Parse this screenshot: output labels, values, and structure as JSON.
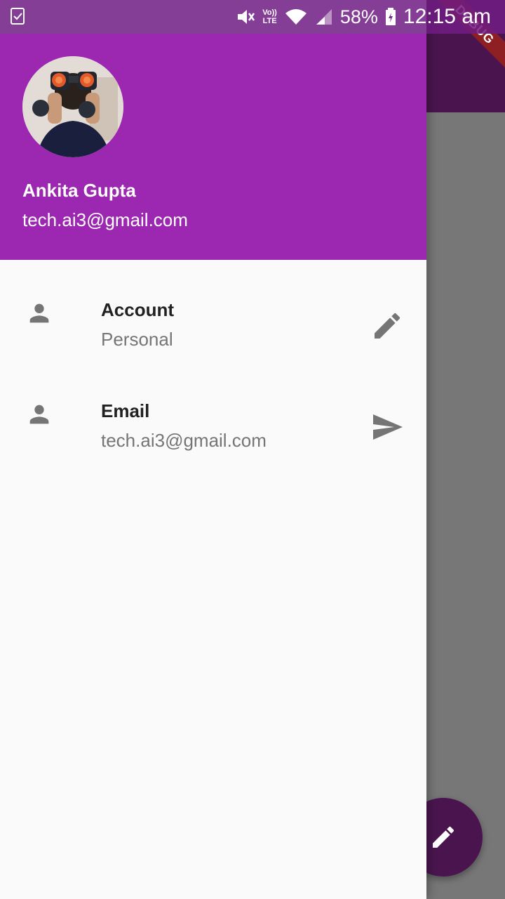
{
  "status_bar": {
    "battery": "58%",
    "time": "12:15 am",
    "network": "LTE",
    "volte": "Vo))"
  },
  "debug_banner": {
    "label": "DEBUG"
  },
  "drawer": {
    "header": {
      "account_name": "Ankita Gupta",
      "account_email": "tech.ai3@gmail.com"
    },
    "items": [
      {
        "title": "Account",
        "subtitle": "Personal",
        "leading_icon": "person-icon",
        "trailing_icon": "edit-icon"
      },
      {
        "title": "Email",
        "subtitle": "tech.ai3@gmail.com",
        "leading_icon": "person-icon",
        "trailing_icon": "send-icon"
      }
    ]
  },
  "colors": {
    "drawer_header": "#9c27b0",
    "app_bar": "#4a154f",
    "scrim": "#777777",
    "icon_grey": "#757575"
  }
}
